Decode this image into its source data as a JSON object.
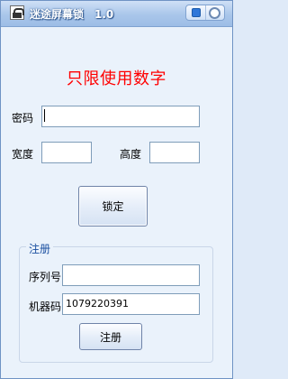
{
  "window": {
    "title": "迷途屏幕锁　1.0",
    "icon": "lock-app-icon"
  },
  "heading": "只限使用数字",
  "password": {
    "label": "密码",
    "value": ""
  },
  "width": {
    "label": "宽度",
    "value": ""
  },
  "height": {
    "label": "高度",
    "value": ""
  },
  "lock_button": "锁定",
  "register": {
    "legend": "注册",
    "serial": {
      "label": "序列号",
      "value": ""
    },
    "machine_code": {
      "label": "机器码",
      "value": "1079220391"
    },
    "button": "注册"
  },
  "colors": {
    "heading": "#ff0000",
    "legend": "#1a4fa0",
    "window_bg": "#eaf2fb"
  }
}
